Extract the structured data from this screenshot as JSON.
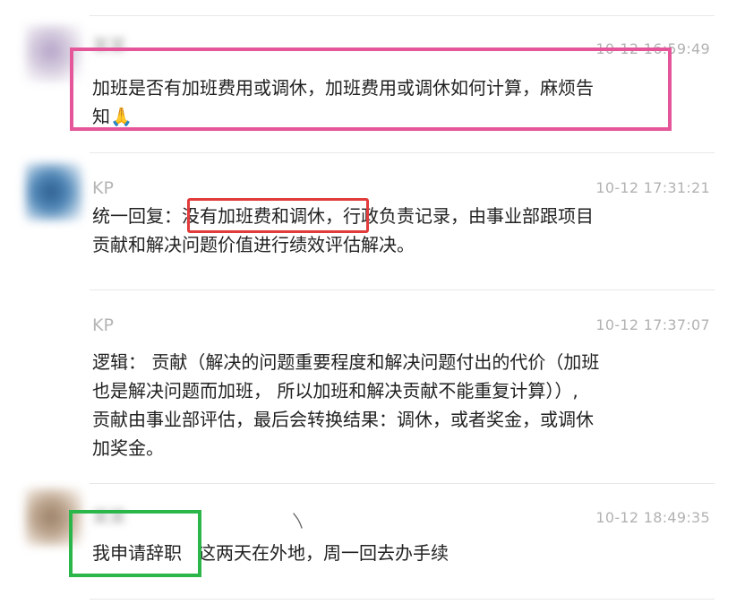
{
  "messages": [
    {
      "sender": "",
      "time": "10-12 16:59:49",
      "text_a": "加班是否有加班费用或调休，加班费用或调休如何计算，麻烦告",
      "text_b": "知",
      "emoji": "🙏"
    },
    {
      "sender": "KP",
      "time": "10-12 17:31:21",
      "line1_prefix": "统一回复：",
      "line1_highlight": "没有加班费和调休，",
      "line1_suffix": "行政负责记录，由事业部跟项目",
      "line2": "贡献和解决问题价值进行绩效评估解决。"
    },
    {
      "sender": "KP",
      "time": "10-12 17:37:07",
      "line1": "逻辑： 贡献（解决的问题重要程度和解决问题付出的代价（加班",
      "line2": "也是解决问题而加班， 所以加班和解决贡献不能重复计算））,",
      "line3": "贡献由事业部评估，最后会转换结果：调休，或者奖金，或调休",
      "line4": "加奖金。"
    },
    {
      "sender": "",
      "time": "10-12 18:49:35",
      "text_highlight": "我申请辞职",
      "text_rest": "这两天在外地，周一回去办手续"
    }
  ],
  "highlight_colors": {
    "pink": "#e5559a",
    "red": "#e23b3b",
    "green": "#2bb64a"
  }
}
